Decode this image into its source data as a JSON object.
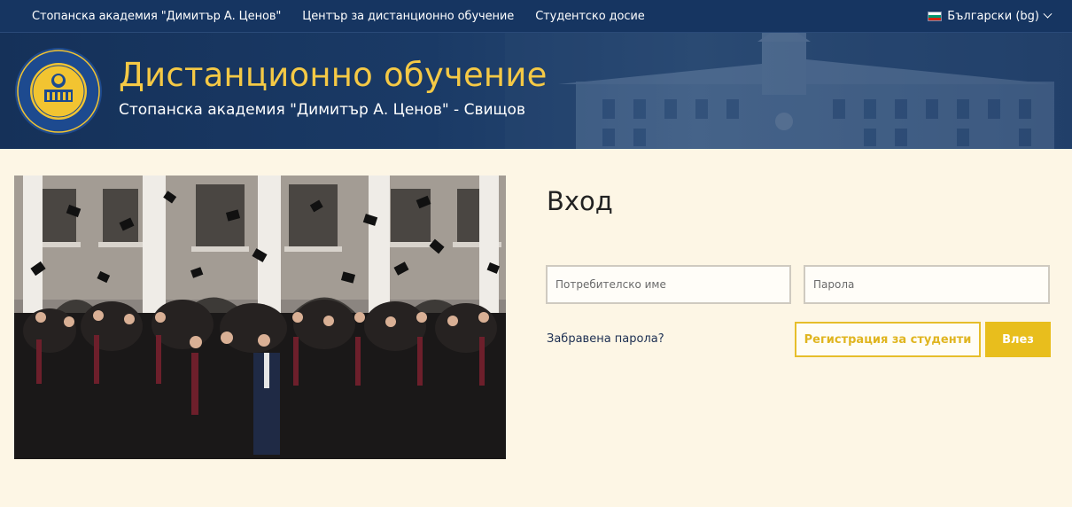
{
  "topnav": {
    "links": [
      "Стопанска академия \"Димитър А. Ценов\"",
      "Център за дистанционно обучение",
      "Студентско досие"
    ],
    "language": "Български (bg)"
  },
  "header": {
    "title": "Дистанционно обучение",
    "subtitle": "Стопанска академия \"Димитър А. Ценов\" - Свищов"
  },
  "login": {
    "title": "Вход",
    "username_placeholder": "Потребителско име",
    "password_placeholder": "Парола",
    "forgot_password": "Забравена парола?",
    "register_button": "Регистрация за студенти",
    "login_button": "Влез"
  },
  "colors": {
    "nav_bg": "#163561",
    "title_gold": "#f5c945",
    "page_bg": "#fdf6e5",
    "accent_yellow": "#e8be1d"
  }
}
